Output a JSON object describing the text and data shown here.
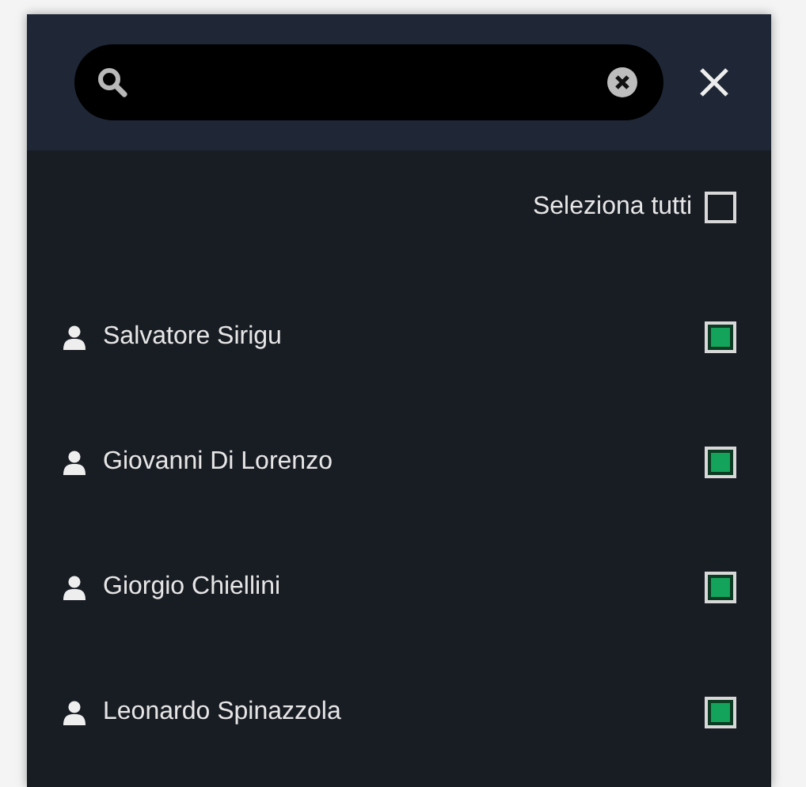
{
  "select_all": {
    "label": "Seleziona tutti",
    "checked": false
  },
  "players": [
    {
      "name": "Salvatore Sirigu",
      "checked": true
    },
    {
      "name": "Giovanni Di Lorenzo",
      "checked": true
    },
    {
      "name": "Giorgio Chiellini",
      "checked": true
    },
    {
      "name": "Leonardo Spinazzola",
      "checked": true
    }
  ]
}
